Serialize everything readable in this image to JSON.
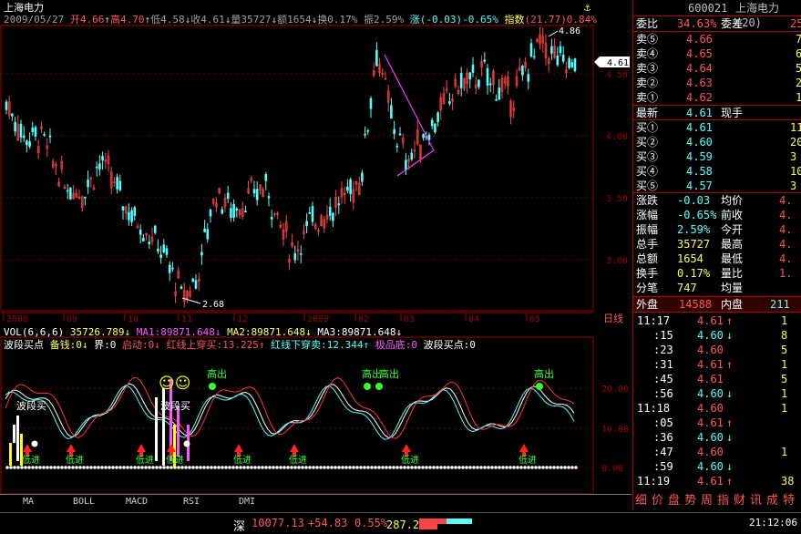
{
  "chart_header": {
    "name": "上海电力",
    "date": "2009/05/27",
    "open_label": "开",
    "open": "4.66",
    "high_label": "高",
    "high": "4.70",
    "low_label": "低",
    "low": "4.58",
    "close_label": "收",
    "close": "4.61",
    "vol_label": "量",
    "vol": "35727",
    "amt_label": "额",
    "amt": "1654",
    "turnover_label": "换",
    "turnover": "0.17%",
    "amp_label": "振",
    "amp": "2.59%",
    "chg_label": "涨",
    "chg": "(-0.03)-0.65%",
    "index_label": "指数",
    "index": "(21.77)0.84%"
  },
  "price_axis": [
    "4.50",
    "4.00",
    "3.50",
    "3.00"
  ],
  "price_tag": "4.61",
  "marks": {
    "high": "4.86",
    "low": "2.68"
  },
  "date_axis": [
    "2008",
    "09",
    "10",
    "11",
    "12",
    "2009",
    "02",
    "03",
    "04",
    "05"
  ],
  "period_label": "日线",
  "vol_header": {
    "label": "VOL(6,6,6)",
    "vol": "35726.789↓",
    "ma1": "MA1:89871.648↓",
    "ma2": "MA2:89871.648↓",
    "ma3": "MA3:89871.648↓"
  },
  "ind_header": {
    "name": "波段买点",
    "beiqian": "备钱:0↓",
    "jie": "界:0",
    "qidong": "启动:0↓",
    "hongxian_up": "红线上穿买:13.225↑",
    "hongxian_down": "红线下穿卖:12.344↑",
    "jipin": "极品底:0",
    "bodian": "波段买点:0"
  },
  "ind_axis": [
    "20.00",
    "10.00",
    "0.00"
  ],
  "ind_labels": {
    "gaochu": "高出",
    "didian": "低进",
    "boduanmai": "波段买",
    "smile": "☺☺"
  },
  "tabs": [
    "MA",
    "BOLL",
    "MACD",
    "RSI",
    "DMI"
  ],
  "side": {
    "code": "600021",
    "name": "上海电力(20)",
    "weibi_label": "委比",
    "weibi": "34.63%",
    "weicha_label": "委差",
    "weicha": "25",
    "asks": [
      {
        "label": "卖⑤",
        "price": "4.66",
        "vol": "7"
      },
      {
        "label": "卖④",
        "price": "4.65",
        "vol": "6"
      },
      {
        "label": "卖③",
        "price": "4.64",
        "vol": "5"
      },
      {
        "label": "卖②",
        "price": "4.63",
        "vol": "2"
      },
      {
        "label": "卖①",
        "price": "4.62",
        "vol": "1"
      }
    ],
    "last_label": "最新",
    "last": "4.61",
    "xianshou_label": "现手",
    "bids": [
      {
        "label": "买①",
        "price": "4.61",
        "vol": "11"
      },
      {
        "label": "买②",
        "price": "4.60",
        "vol": "20"
      },
      {
        "label": "买③",
        "price": "4.59",
        "vol": "3"
      },
      {
        "label": "买④",
        "price": "4.58",
        "vol": "10"
      },
      {
        "label": "买⑤",
        "price": "4.57",
        "vol": "3"
      }
    ],
    "stats": [
      {
        "l1": "涨跌",
        "v1": "-0.03",
        "l2": "均价",
        "v2": "4."
      },
      {
        "l1": "涨幅",
        "v1": "-0.65%",
        "l2": "前收",
        "v2": "4."
      },
      {
        "l1": "振幅",
        "v1": "2.59%",
        "l2": "今开",
        "v2": "4."
      },
      {
        "l1": "总手",
        "v1": "35727",
        "l2": "最高",
        "v2": "4."
      },
      {
        "l1": "总额",
        "v1": "1654",
        "l2": "最低",
        "v2": "4."
      },
      {
        "l1": "换手",
        "v1": "0.17%",
        "l2": "量比",
        "v2": "1."
      },
      {
        "l1": "分笔",
        "v1": "747",
        "l2": "均量",
        "v2": ""
      }
    ],
    "waipan_label": "外盘",
    "waipan": "14588",
    "neipan_label": "内盘",
    "neipan": "211",
    "ticks": [
      {
        "t": "11:17",
        "p": "4.61",
        "a": "↑",
        "v": "1"
      },
      {
        "t": ":15",
        "p": "4.60",
        "a": "↓",
        "v": "8"
      },
      {
        "t": ":23",
        "p": "4.60",
        "a": "",
        "v": "5"
      },
      {
        "t": ":31",
        "p": "4.61",
        "a": "↑",
        "v": "1"
      },
      {
        "t": ":45",
        "p": "4.61",
        "a": "",
        "v": "5"
      },
      {
        "t": ":56",
        "p": "4.60",
        "a": "↓",
        "v": "1"
      },
      {
        "t": "11:18",
        "p": "4.60",
        "a": "",
        "v": "1"
      },
      {
        "t": ":05",
        "p": "4.61",
        "a": "↑",
        "v": ""
      },
      {
        "t": ":36",
        "p": "4.60",
        "a": "↓",
        "v": ""
      },
      {
        "t": ":47",
        "p": "4.60",
        "a": "",
        "v": "1"
      },
      {
        "t": ":59",
        "p": "4.60",
        "a": "↓",
        "v": ""
      },
      {
        "t": "11:19",
        "p": "4.61",
        "a": "↑",
        "v": "38"
      }
    ],
    "bottom_tabs": [
      "细",
      "价",
      "盘",
      "势",
      "周",
      "指",
      "财",
      "讯",
      "成",
      "特"
    ]
  },
  "status": {
    "market": "深",
    "index": "10077.13",
    "chg": "+54.83",
    "pct": "0.55%",
    "amount": "287.24亿",
    "clock": "21:12:06"
  },
  "colors": {
    "up": "#ff4444",
    "down": "#55ffff",
    "accent": "#ffff00",
    "grid": "#a00000"
  }
}
